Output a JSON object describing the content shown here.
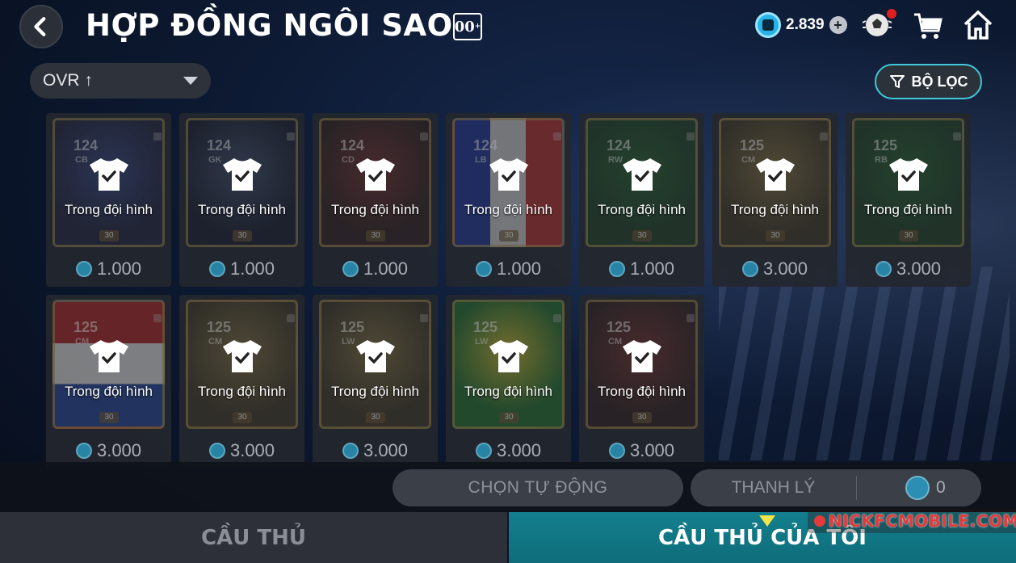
{
  "header": {
    "title": "HỢP ĐỒNG NGÔI SAO",
    "badge": "00",
    "badge_sup": "+",
    "coin_balance": "2.839"
  },
  "sort": {
    "label": "OVR ↑"
  },
  "filter": {
    "label": "BỘ LỌC"
  },
  "cards": [
    {
      "ovr": "124",
      "pos": "CB",
      "status": "Trong đội hình",
      "price": "1.000",
      "level": "30",
      "art": "art-blue"
    },
    {
      "ovr": "124",
      "pos": "GK",
      "status": "Trong đội hình",
      "price": "1.000",
      "level": "30",
      "art": "art-navy"
    },
    {
      "ovr": "124",
      "pos": "CD",
      "status": "Trong đội hình",
      "price": "1.000",
      "level": "30",
      "art": "art-red"
    },
    {
      "ovr": "124",
      "pos": "LB",
      "status": "Trong đội hình",
      "price": "1.000",
      "level": "30",
      "art": "art-fr"
    },
    {
      "ovr": "124",
      "pos": "RW",
      "status": "Trong đội hình",
      "price": "1.000",
      "level": "30",
      "art": "art-green"
    },
    {
      "ovr": "125",
      "pos": "CM",
      "status": "Trong đội hình",
      "price": "3.000",
      "level": "30",
      "art": "art-gold"
    },
    {
      "ovr": "125",
      "pos": "RB",
      "status": "Trong đội hình",
      "price": "3.000",
      "level": "30",
      "art": "art-green"
    },
    {
      "ovr": "125",
      "pos": "CM",
      "status": "Trong đội hình",
      "price": "3.000",
      "level": "30",
      "art": "art-nl"
    },
    {
      "ovr": "125",
      "pos": "CM",
      "status": "Trong đội hình",
      "price": "3.000",
      "level": "30",
      "art": "art-gold"
    },
    {
      "ovr": "125",
      "pos": "LW",
      "status": "Trong đội hình",
      "price": "3.000",
      "level": "30",
      "art": "art-gold"
    },
    {
      "ovr": "125",
      "pos": "LW",
      "status": "Trong đội hình",
      "price": "3.000",
      "level": "30",
      "art": "art-br"
    },
    {
      "ovr": "125",
      "pos": "CM",
      "status": "Trong đội hình",
      "price": "3.000",
      "level": "30",
      "art": "art-red"
    }
  ],
  "actions": {
    "auto_select": "CHỌN TỰ ĐỘNG",
    "sell": "THANH LÝ",
    "sell_total": "0"
  },
  "tabs": {
    "players": "CẦU THỦ",
    "my_players": "CẦU THỦ CỦA TÔI"
  },
  "watermark": "NICKFCMOBILE.COM"
}
